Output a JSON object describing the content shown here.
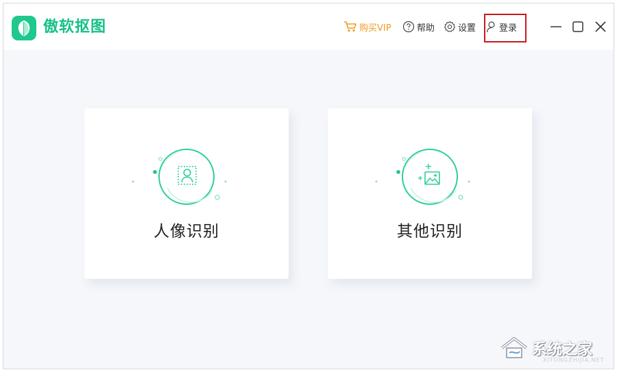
{
  "app": {
    "title": "傲软抠图"
  },
  "toolbar": {
    "vip_label": "购买VIP",
    "help_label": "帮助",
    "settings_label": "设置",
    "login_label": "登录"
  },
  "cards": [
    {
      "label": "人像识别"
    },
    {
      "label": "其他识别"
    }
  ],
  "watermark": {
    "text": "系统之家",
    "sub": "XITONGZHIJIA.NET"
  },
  "colors": {
    "brand": "#1fc98e",
    "vip": "#f29b1e",
    "highlight": "#c8171e",
    "background": "#f5f7fa"
  },
  "icons": {
    "logo": "leaf-logo-icon",
    "vip": "cart-icon",
    "help": "help-circle-icon",
    "settings": "gear-icon",
    "login": "user-icon",
    "portrait": "portrait-recognition-icon",
    "other": "image-recognition-icon"
  }
}
